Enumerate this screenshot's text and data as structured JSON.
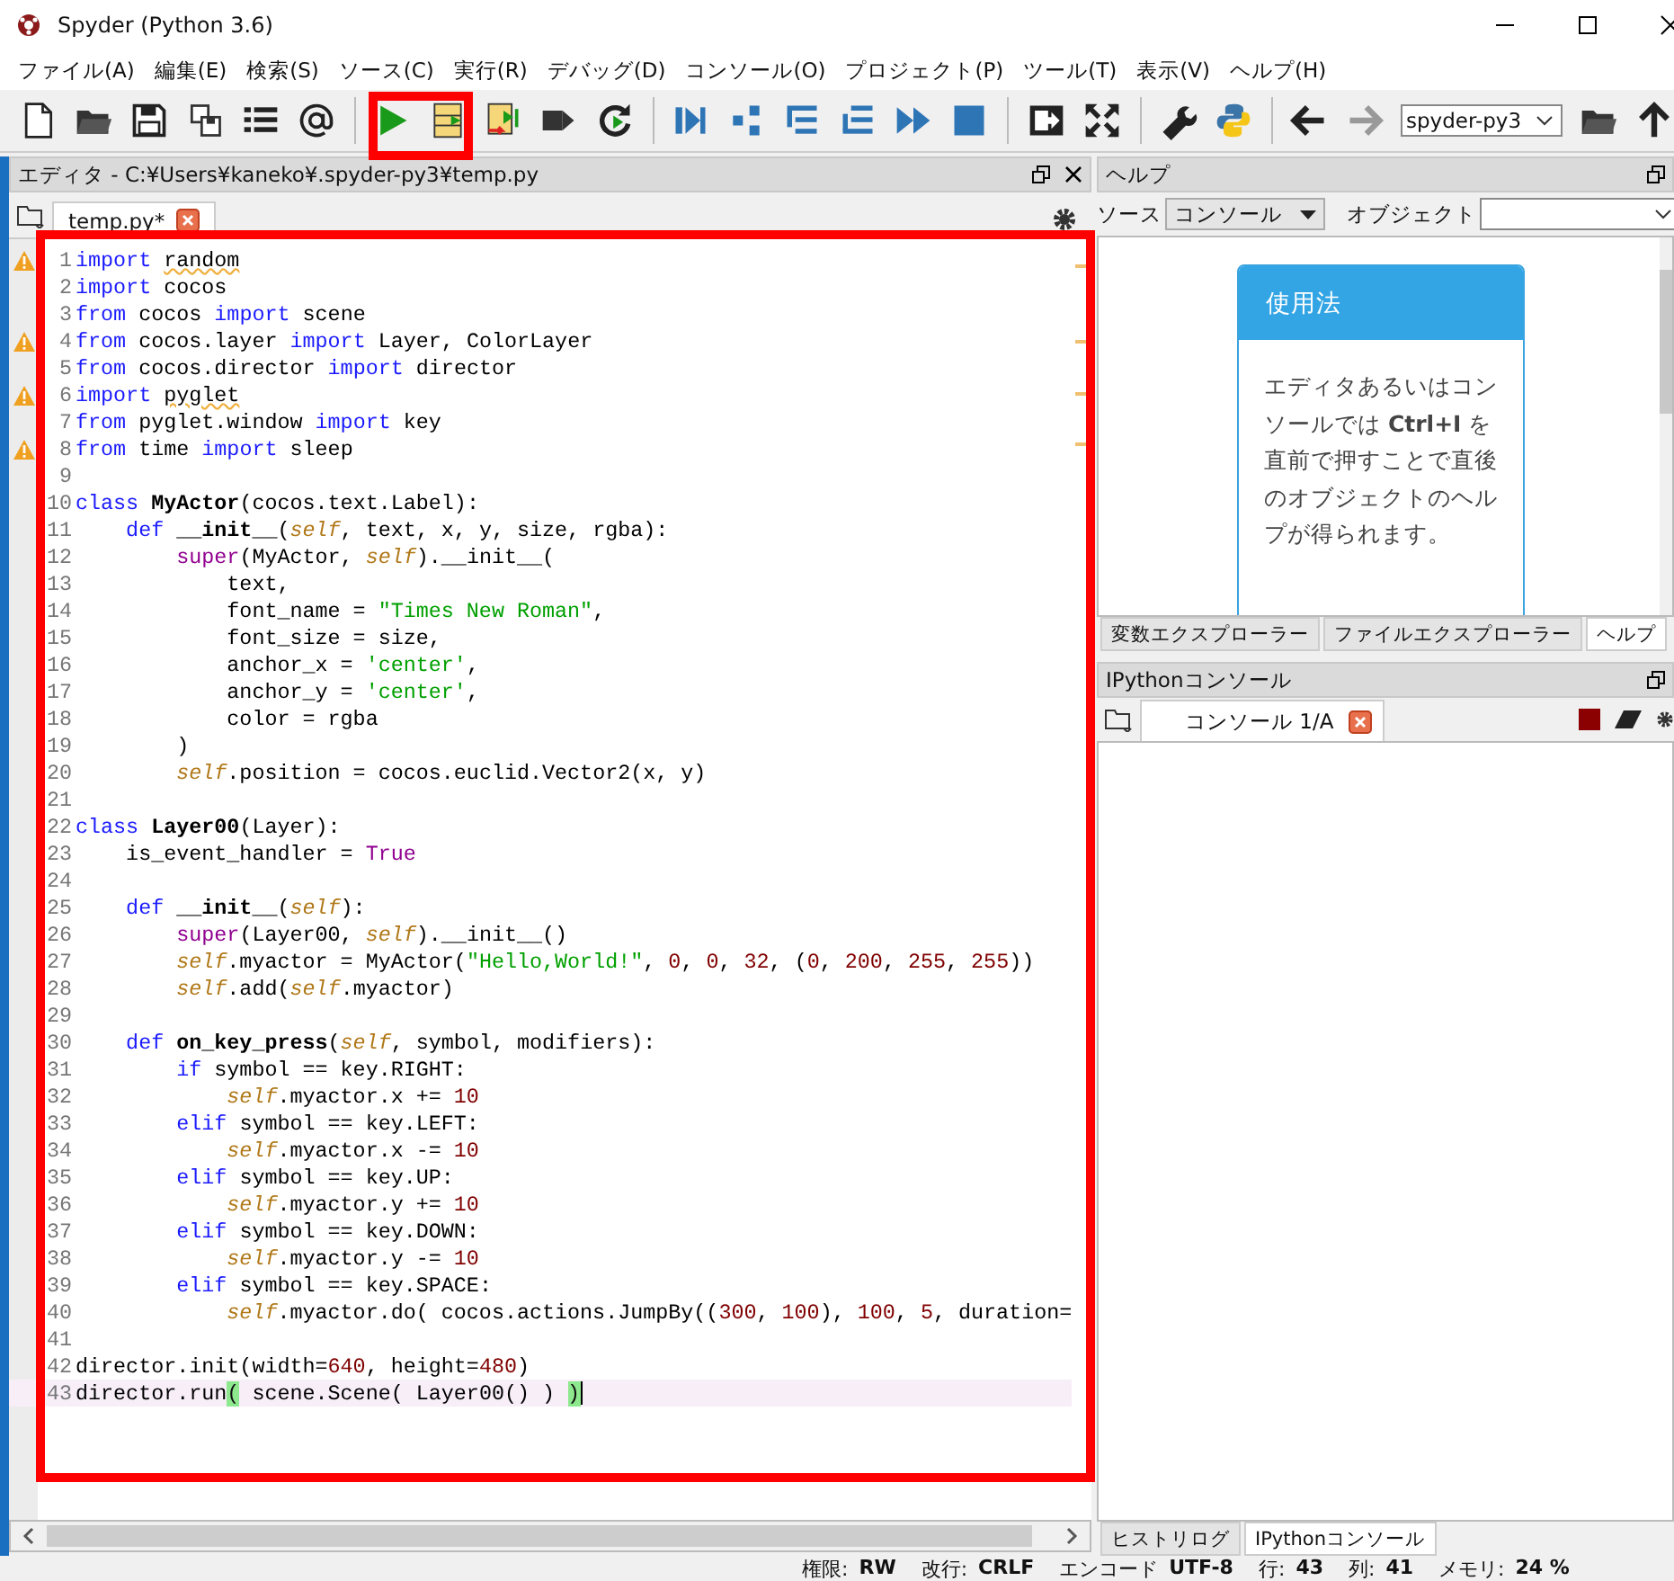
{
  "window": {
    "title": "Spyder (Python 3.6)"
  },
  "menu": [
    "ファイル(A)",
    "編集(E)",
    "検索(S)",
    "ソース(C)",
    "実行(R)",
    "デバッグ(D)",
    "コンソール(O)",
    "プロジェクト(P)",
    "ツール(T)",
    "表示(V)",
    "ヘルプ(H)"
  ],
  "toolbar": {
    "environment": "spyder-py3"
  },
  "editor": {
    "title": "エディタ - C:¥Users¥kaneko¥.spyder-py3¥temp.py",
    "tabs": [
      {
        "label": "temp.py*",
        "selected": true
      }
    ],
    "lines": [
      {
        "n": "1",
        "warning": true,
        "current": false,
        "tokens": [
          {
            "kind": "keyword",
            "text": "import "
          },
          {
            "kind": "unused",
            "text": "random"
          }
        ]
      },
      {
        "n": "2",
        "warning": false,
        "current": false,
        "tokens": [
          {
            "kind": "keyword",
            "text": "import "
          },
          {
            "kind": "plain",
            "text": "cocos"
          }
        ]
      },
      {
        "n": "3",
        "warning": false,
        "current": false,
        "tokens": [
          {
            "kind": "keyword",
            "text": "from "
          },
          {
            "kind": "plain",
            "text": "cocos "
          },
          {
            "kind": "keyword",
            "text": "import "
          },
          {
            "kind": "plain",
            "text": "scene"
          }
        ]
      },
      {
        "n": "4",
        "warning": true,
        "current": false,
        "tokens": [
          {
            "kind": "keyword",
            "text": "from "
          },
          {
            "kind": "plain",
            "text": "cocos.layer "
          },
          {
            "kind": "keyword",
            "text": "import "
          },
          {
            "kind": "plain",
            "text": "Layer, ColorLayer"
          }
        ]
      },
      {
        "n": "5",
        "warning": false,
        "current": false,
        "tokens": [
          {
            "kind": "keyword",
            "text": "from "
          },
          {
            "kind": "plain",
            "text": "cocos.director "
          },
          {
            "kind": "keyword",
            "text": "import "
          },
          {
            "kind": "plain",
            "text": "director"
          }
        ]
      },
      {
        "n": "6",
        "warning": true,
        "current": false,
        "tokens": [
          {
            "kind": "keyword",
            "text": "import "
          },
          {
            "kind": "unused",
            "text": "pyglet"
          }
        ]
      },
      {
        "n": "7",
        "warning": false,
        "current": false,
        "tokens": [
          {
            "kind": "keyword",
            "text": "from "
          },
          {
            "kind": "plain",
            "text": "pyglet.window "
          },
          {
            "kind": "keyword",
            "text": "import "
          },
          {
            "kind": "plain",
            "text": "key"
          }
        ]
      },
      {
        "n": "8",
        "warning": true,
        "current": false,
        "tokens": [
          {
            "kind": "keyword",
            "text": "from "
          },
          {
            "kind": "plain",
            "text": "time "
          },
          {
            "kind": "keyword",
            "text": "import "
          },
          {
            "kind": "plain",
            "text": "sleep"
          }
        ]
      },
      {
        "n": "9",
        "warning": false,
        "current": false
      },
      {
        "n": "10",
        "warning": false,
        "current": false,
        "tokens": [
          {
            "kind": "keyword",
            "text": "class "
          },
          {
            "kind": "definition",
            "text": "MyActor"
          },
          {
            "kind": "plain",
            "text": "(cocos.text.Label):"
          }
        ]
      },
      {
        "n": "11",
        "warning": false,
        "current": false,
        "tokens": [
          {
            "kind": "keyword",
            "text": "    def "
          },
          {
            "kind": "definition",
            "text": "__init__"
          },
          {
            "kind": "plain",
            "text": "("
          },
          {
            "kind": "self",
            "text": "self"
          },
          {
            "kind": "plain",
            "text": ", text, x, y, size, rgba):"
          }
        ]
      },
      {
        "n": "12",
        "warning": false,
        "current": false,
        "tokens": [
          {
            "kind": "builtin",
            "text": "        super"
          },
          {
            "kind": "plain",
            "text": "(MyActor, "
          },
          {
            "kind": "self",
            "text": "self"
          },
          {
            "kind": "plain",
            "text": ").__init__("
          }
        ]
      },
      {
        "n": "13",
        "warning": false,
        "current": false,
        "tokens": [
          {
            "kind": "plain",
            "text": "            text,"
          }
        ]
      },
      {
        "n": "14",
        "warning": false,
        "current": false,
        "tokens": [
          {
            "kind": "plain",
            "text": "            font_name = "
          },
          {
            "kind": "string",
            "text": "\"Times New Roman\""
          },
          {
            "kind": "plain",
            "text": ","
          }
        ]
      },
      {
        "n": "15",
        "warning": false,
        "current": false,
        "tokens": [
          {
            "kind": "plain",
            "text": "            font_size = size,"
          }
        ]
      },
      {
        "n": "16",
        "warning": false,
        "current": false,
        "tokens": [
          {
            "kind": "plain",
            "text": "            anchor_x = "
          },
          {
            "kind": "string",
            "text": "'center'"
          },
          {
            "kind": "plain",
            "text": ","
          }
        ]
      },
      {
        "n": "17",
        "warning": false,
        "current": false,
        "tokens": [
          {
            "kind": "plain",
            "text": "            anchor_y = "
          },
          {
            "kind": "string",
            "text": "'center'"
          },
          {
            "kind": "plain",
            "text": ","
          }
        ]
      },
      {
        "n": "18",
        "warning": false,
        "current": false,
        "tokens": [
          {
            "kind": "plain",
            "text": "            color = rgba"
          }
        ]
      },
      {
        "n": "19",
        "warning": false,
        "current": false,
        "tokens": [
          {
            "kind": "plain",
            "text": "        )"
          }
        ]
      },
      {
        "n": "20",
        "warning": false,
        "current": false,
        "tokens": [
          {
            "kind": "self",
            "text": "        self"
          },
          {
            "kind": "plain",
            "text": ".position = cocos.euclid.Vector2(x, y)"
          }
        ]
      },
      {
        "n": "21",
        "warning": false,
        "current": false
      },
      {
        "n": "22",
        "warning": false,
        "current": false,
        "tokens": [
          {
            "kind": "keyword",
            "text": "class "
          },
          {
            "kind": "definition",
            "text": "Layer00"
          },
          {
            "kind": "plain",
            "text": "(Layer):"
          }
        ]
      },
      {
        "n": "23",
        "warning": false,
        "current": false,
        "tokens": [
          {
            "kind": "plain",
            "text": "    is_event_handler = "
          },
          {
            "kind": "builtin",
            "text": "True"
          }
        ]
      },
      {
        "n": "24",
        "warning": false,
        "current": false
      },
      {
        "n": "25",
        "warning": false,
        "current": false,
        "tokens": [
          {
            "kind": "keyword",
            "text": "    def "
          },
          {
            "kind": "definition",
            "text": "__init__"
          },
          {
            "kind": "plain",
            "text": "("
          },
          {
            "kind": "self",
            "text": "self"
          },
          {
            "kind": "plain",
            "text": "):"
          }
        ]
      },
      {
        "n": "26",
        "warning": false,
        "current": false,
        "tokens": [
          {
            "kind": "builtin",
            "text": "        super"
          },
          {
            "kind": "plain",
            "text": "(Layer00, "
          },
          {
            "kind": "self",
            "text": "self"
          },
          {
            "kind": "plain",
            "text": ").__init__()"
          }
        ]
      },
      {
        "n": "27",
        "warning": false,
        "current": false,
        "tokens": [
          {
            "kind": "self",
            "text": "        self"
          },
          {
            "kind": "plain",
            "text": ".myactor = MyActor("
          },
          {
            "kind": "string",
            "text": "\"Hello,World!\""
          },
          {
            "kind": "plain",
            "text": ", "
          },
          {
            "kind": "number",
            "text": "0"
          },
          {
            "kind": "plain",
            "text": ", "
          },
          {
            "kind": "number",
            "text": "0"
          },
          {
            "kind": "plain",
            "text": ", "
          },
          {
            "kind": "number",
            "text": "32"
          },
          {
            "kind": "plain",
            "text": ", ("
          },
          {
            "kind": "number",
            "text": "0"
          },
          {
            "kind": "plain",
            "text": ", "
          },
          {
            "kind": "number",
            "text": "200"
          },
          {
            "kind": "plain",
            "text": ", "
          },
          {
            "kind": "number",
            "text": "255"
          },
          {
            "kind": "plain",
            "text": ", "
          },
          {
            "kind": "number",
            "text": "255"
          },
          {
            "kind": "plain",
            "text": "))"
          }
        ]
      },
      {
        "n": "28",
        "warning": false,
        "current": false,
        "tokens": [
          {
            "kind": "self",
            "text": "        self"
          },
          {
            "kind": "plain",
            "text": ".add("
          },
          {
            "kind": "self",
            "text": "self"
          },
          {
            "kind": "plain",
            "text": ".myactor)"
          }
        ]
      },
      {
        "n": "29",
        "warning": false,
        "current": false
      },
      {
        "n": "30",
        "warning": false,
        "current": false,
        "tokens": [
          {
            "kind": "keyword",
            "text": "    def "
          },
          {
            "kind": "definition",
            "text": "on_key_press"
          },
          {
            "kind": "plain",
            "text": "("
          },
          {
            "kind": "self",
            "text": "self"
          },
          {
            "kind": "plain",
            "text": ", symbol, modifiers):"
          }
        ]
      },
      {
        "n": "31",
        "warning": false,
        "current": false,
        "tokens": [
          {
            "kind": "keyword",
            "text": "        if "
          },
          {
            "kind": "plain",
            "text": "symbol == key.RIGHT:"
          }
        ]
      },
      {
        "n": "32",
        "warning": false,
        "current": false,
        "tokens": [
          {
            "kind": "self",
            "text": "            self"
          },
          {
            "kind": "plain",
            "text": ".myactor.x += "
          },
          {
            "kind": "number",
            "text": "10"
          }
        ]
      },
      {
        "n": "33",
        "warning": false,
        "current": false,
        "tokens": [
          {
            "kind": "keyword",
            "text": "        elif "
          },
          {
            "kind": "plain",
            "text": "symbol == key.LEFT:"
          }
        ]
      },
      {
        "n": "34",
        "warning": false,
        "current": false,
        "tokens": [
          {
            "kind": "self",
            "text": "            self"
          },
          {
            "kind": "plain",
            "text": ".myactor.x -= "
          },
          {
            "kind": "number",
            "text": "10"
          }
        ]
      },
      {
        "n": "35",
        "warning": false,
        "current": false,
        "tokens": [
          {
            "kind": "keyword",
            "text": "        elif "
          },
          {
            "kind": "plain",
            "text": "symbol == key.UP:"
          }
        ]
      },
      {
        "n": "36",
        "warning": false,
        "current": false,
        "tokens": [
          {
            "kind": "self",
            "text": "            self"
          },
          {
            "kind": "plain",
            "text": ".myactor.y += "
          },
          {
            "kind": "number",
            "text": "10"
          }
        ]
      },
      {
        "n": "37",
        "warning": false,
        "current": false,
        "tokens": [
          {
            "kind": "keyword",
            "text": "        elif "
          },
          {
            "kind": "plain",
            "text": "symbol == key.DOWN:"
          }
        ]
      },
      {
        "n": "38",
        "warning": false,
        "current": false,
        "tokens": [
          {
            "kind": "self",
            "text": "            self"
          },
          {
            "kind": "plain",
            "text": ".myactor.y -= "
          },
          {
            "kind": "number",
            "text": "10"
          }
        ]
      },
      {
        "n": "39",
        "warning": false,
        "current": false,
        "tokens": [
          {
            "kind": "keyword",
            "text": "        elif "
          },
          {
            "kind": "plain",
            "text": "symbol == key.SPACE:"
          }
        ]
      },
      {
        "n": "40",
        "warning": false,
        "current": false,
        "tokens": [
          {
            "kind": "self",
            "text": "            self"
          },
          {
            "kind": "plain",
            "text": ".myactor.do( cocos.actions.JumpBy(("
          },
          {
            "kind": "number",
            "text": "300"
          },
          {
            "kind": "plain",
            "text": ", "
          },
          {
            "kind": "number",
            "text": "100"
          },
          {
            "kind": "plain",
            "text": "), "
          },
          {
            "kind": "number",
            "text": "100"
          },
          {
            "kind": "plain",
            "text": ", "
          },
          {
            "kind": "number",
            "text": "5"
          },
          {
            "kind": "plain",
            "text": ", duration="
          }
        ]
      },
      {
        "n": "41",
        "warning": false,
        "current": false
      },
      {
        "n": "42",
        "warning": false,
        "current": false,
        "tokens": [
          {
            "kind": "plain",
            "text": "director.init(width="
          },
          {
            "kind": "number",
            "text": "640"
          },
          {
            "kind": "plain",
            "text": ", height="
          },
          {
            "kind": "number",
            "text": "480"
          },
          {
            "kind": "plain",
            "text": ")"
          }
        ]
      },
      {
        "n": "43",
        "warning": false,
        "current": true,
        "tokens": [
          {
            "kind": "plain",
            "text": "director.run"
          },
          {
            "kind": "bracket",
            "text": "("
          },
          {
            "kind": "plain",
            "text": " scene.Scene( Layer00() ) "
          },
          {
            "kind": "bracket",
            "text": ")"
          }
        ]
      }
    ]
  },
  "help": {
    "title": "ヘルプ",
    "source_label": "ソース",
    "source": "コンソール",
    "object_label": "オブジェクト",
    "card_title": "使用法",
    "card_text": "エディタあるいはコンソールでは **Ctrl+I** を直前で押すことで直後のオブジェクトのヘルプが得られます。",
    "tabs": [
      {
        "label": "変数エクスプローラー",
        "selected": false
      },
      {
        "label": "ファイルエクスプローラー",
        "selected": false
      },
      {
        "label": "ヘルプ",
        "selected": true
      }
    ]
  },
  "console": {
    "title": "IPythonコンソール",
    "tabs": [
      {
        "label": "コンソール 1/A",
        "selected": true
      }
    ],
    "bottom_tabs": [
      {
        "label": "ヒストリログ",
        "selected": false
      },
      {
        "label": "IPythonコンソール",
        "selected": true
      }
    ]
  },
  "status_bar": [
    {
      "label": "権限:",
      "value": "RW"
    },
    {
      "label": "改行:",
      "value": "CRLF"
    },
    {
      "label": "エンコード",
      "value": "UTF-8"
    },
    {
      "label": "行:",
      "value": "43"
    },
    {
      "label": "列:",
      "value": "41"
    },
    {
      "label": "メモリ:",
      "value": "24 %"
    }
  ]
}
